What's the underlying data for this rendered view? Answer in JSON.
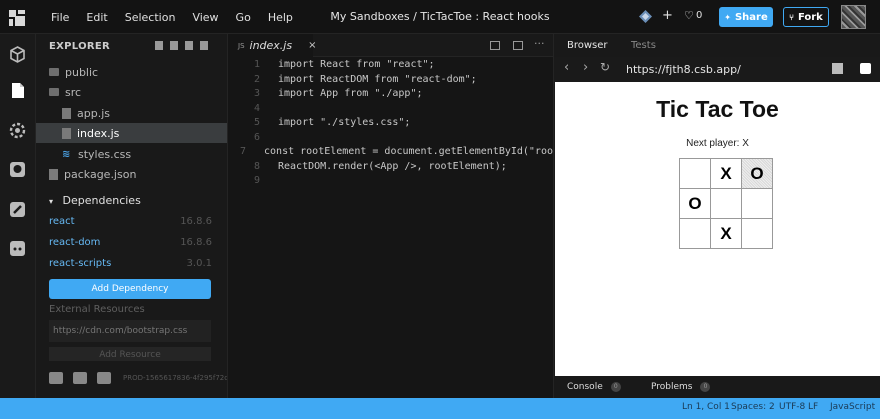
{
  "menu": [
    "File",
    "Edit",
    "Selection",
    "View",
    "Go",
    "Help"
  ],
  "sandbox_title": "My Sandboxes / TicTacToe : React hooks",
  "toolbar": {
    "likes": "0",
    "share_label": "Share",
    "fork_label": "Fork"
  },
  "explorer": {
    "title": "EXPLORER",
    "tree": [
      {
        "name": "public",
        "type": "folder"
      },
      {
        "name": "src",
        "type": "folder"
      },
      {
        "name": "app.js",
        "type": "file"
      },
      {
        "name": "index.js",
        "type": "file",
        "active": true
      },
      {
        "name": "styles.css",
        "type": "css"
      },
      {
        "name": "package.json",
        "type": "file"
      }
    ],
    "dependencies_title": "Dependencies",
    "dependencies": [
      {
        "name": "react",
        "version": "16.8.6"
      },
      {
        "name": "react-dom",
        "version": "16.8.6"
      },
      {
        "name": "react-scripts",
        "version": "3.0.1"
      }
    ],
    "add_dependency_label": "Add Dependency",
    "external_resources_label": "External Resources",
    "cdn_placeholder": "https://cdn.com/bootstrap.css",
    "add_resource_label": "Add Resource",
    "prod_id": "PROD-1565617836-4f295f72c"
  },
  "editor": {
    "tab_prefix": "JS",
    "tab_name": "index.js",
    "tab_close": "×",
    "lines": [
      "import React from \"react\";",
      "import ReactDOM from \"react-dom\";",
      "import App from \"./app\";",
      "",
      "import \"./styles.css\";",
      "",
      "const rootElement = document.getElementById(\"roo",
      "ReactDOM.render(<App />, rootElement);",
      ""
    ]
  },
  "browser": {
    "tabs": [
      "Browser",
      "Tests"
    ],
    "url": "https://fjth8.csb.app/",
    "game_title": "Tic Tac Toe",
    "next_player": "Next player: X",
    "board": [
      "",
      "X",
      "O",
      "O",
      "",
      "",
      "",
      "X",
      ""
    ],
    "console_label": "Console",
    "console_count": "0",
    "problems_label": "Problems",
    "problems_count": "0"
  },
  "status": {
    "position": "Ln 1, Col 1",
    "spaces": "Spaces: 2",
    "encoding": "UTF-8",
    "eol": "LF",
    "language": "JavaScript"
  },
  "colors": {
    "accent": "#40a9f3",
    "dependency": "#66b9f4",
    "background": "#1c1c1c"
  },
  "icons": [
    "codesandbox-logo-icon",
    "cube-icon",
    "file-icon",
    "settings-icon",
    "github-icon",
    "rocket-icon",
    "discord-icon"
  ]
}
